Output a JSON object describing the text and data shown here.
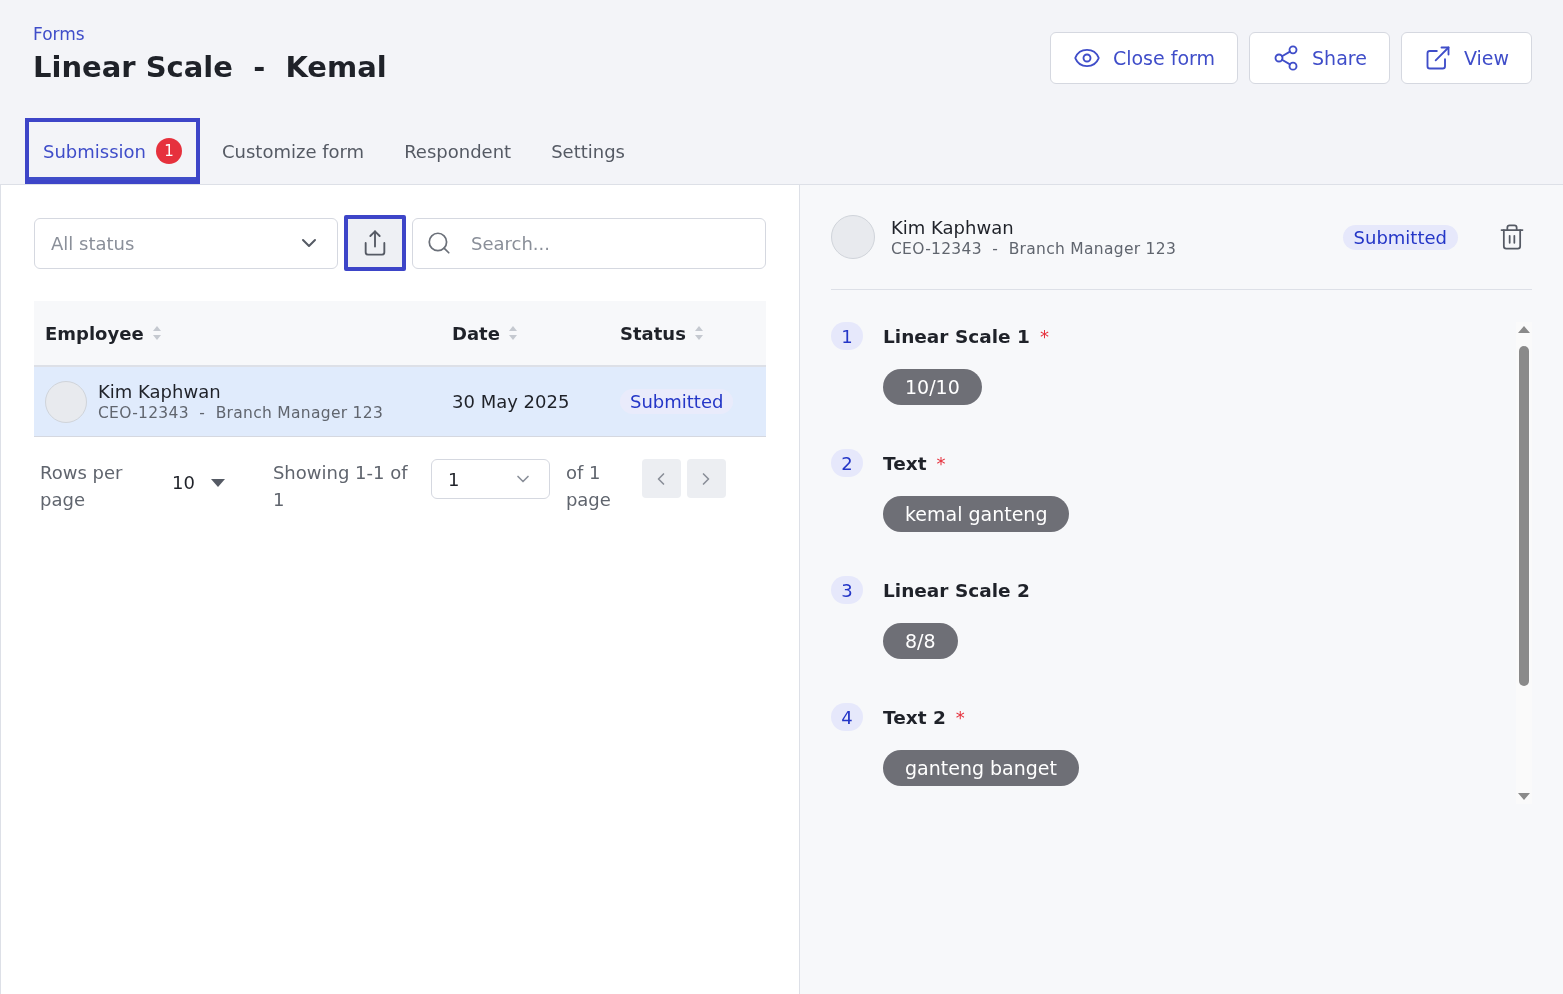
{
  "header": {
    "breadcrumb": "Forms",
    "title": "Linear Scale  -  Kemal",
    "actions": [
      {
        "kind": "eye",
        "label": "Close form"
      },
      {
        "kind": "share",
        "label": "Share"
      },
      {
        "kind": "external",
        "label": "View"
      }
    ]
  },
  "tabs": [
    {
      "label": "Submission",
      "selected": true,
      "badge": "1",
      "highlighted": true
    },
    {
      "label": "Customize form",
      "selected": false,
      "highlighted": false
    },
    {
      "label": "Respondent",
      "selected": false,
      "highlighted": false
    },
    {
      "label": "Settings",
      "selected": false,
      "highlighted": false
    }
  ],
  "filters": {
    "status_select": "All status",
    "export_highlighted": true,
    "search": {
      "placeholder": "Search..."
    }
  },
  "table": {
    "columns": [
      "Employee",
      "Date",
      "Status"
    ],
    "rows": [
      {
        "name": "Kim Kaphwan",
        "subtitle": "CEO-12343  -  Branch Manager 123",
        "date": "30 May 2025",
        "status": "Submitted",
        "selected": true
      }
    ]
  },
  "pagination": {
    "rows_per_page_label": "Rows per page",
    "rows_per_page": "10",
    "showing": "Showing 1-1 of 1",
    "page": "1",
    "of_pages": "of 1 page"
  },
  "detail": {
    "name": "Kim Kaphwan",
    "subtitle": "CEO-12343  -  Branch Manager 123",
    "status": "Submitted",
    "questions": [
      {
        "number": "1",
        "label": "Linear Scale 1",
        "required_mark": "*",
        "answer": "10/10"
      },
      {
        "number": "2",
        "label": "Text",
        "required_mark": "*",
        "answer": "kemal ganteng"
      },
      {
        "number": "3",
        "label": "Linear Scale 2",
        "answer": "8/8"
      },
      {
        "number": "4",
        "label": "Text 2",
        "required_mark": "*",
        "answer": "ganteng banget"
      }
    ]
  }
}
